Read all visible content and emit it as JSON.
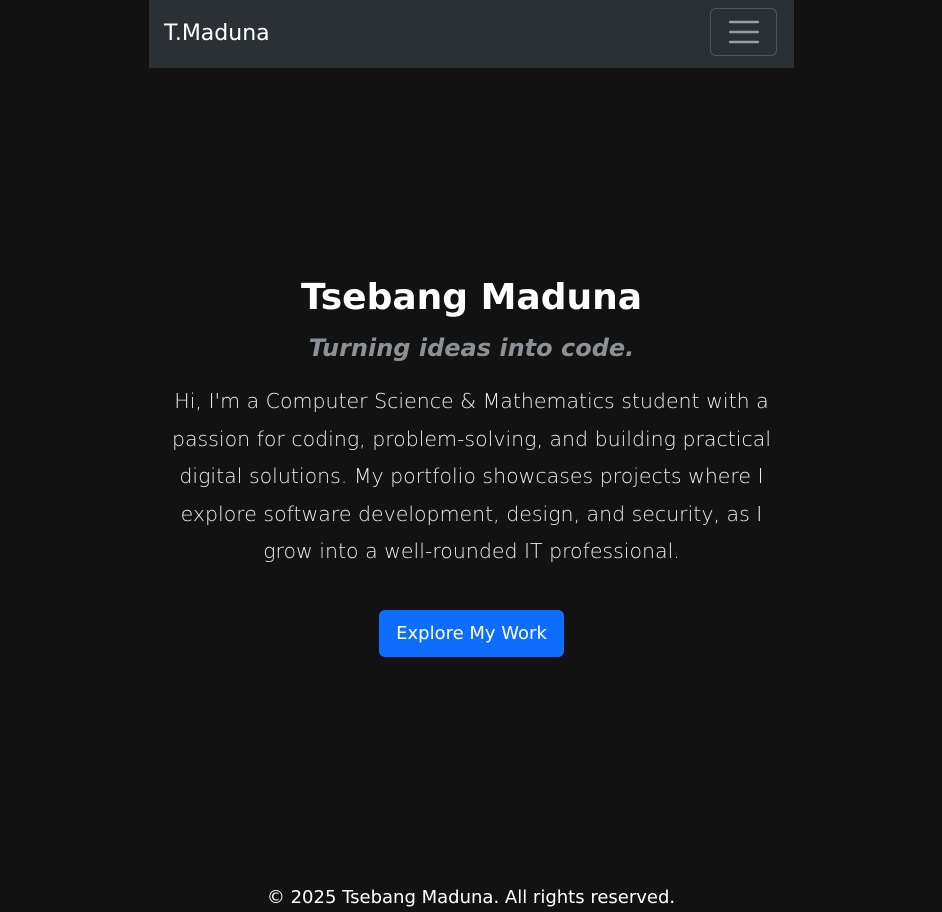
{
  "navbar": {
    "brand": "T.Maduna",
    "toggler_icon": "hamburger-menu-icon"
  },
  "hero": {
    "title": "Tsebang Maduna",
    "tagline": "Turning ideas into code.",
    "intro": "Hi, I'm a Computer Science & Mathematics student with a passion for coding, problem-solving, and building practical digital solutions. My portfolio showcases projects where I explore software development, design, and security, as I grow into a well-rounded IT professional.",
    "cta_label": "Explore My Work"
  },
  "footer": {
    "copyright": "© 2025 Tsebang Maduna. All rights reserved."
  },
  "colors": {
    "page_background": "#121212",
    "navbar_background": "#2b3035",
    "tagline": "#8c9196",
    "primary_button": "#0d6efd"
  }
}
